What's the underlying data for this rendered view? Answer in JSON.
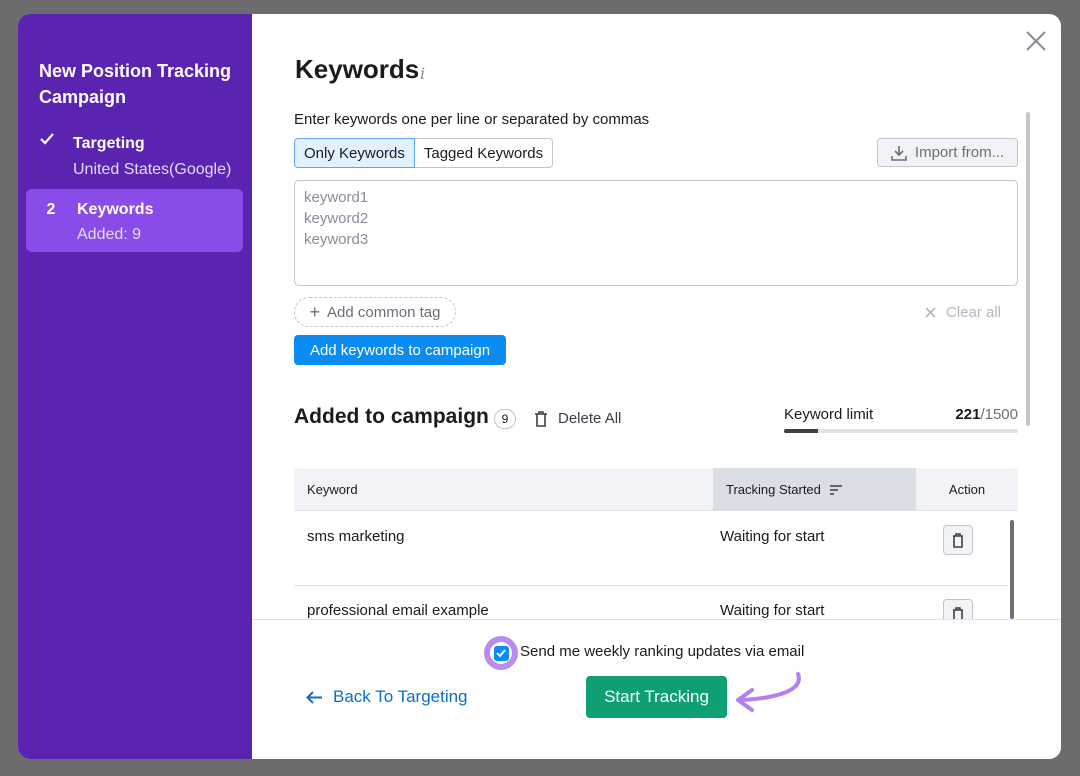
{
  "sidebar": {
    "title": "New Position Tracking Campaign",
    "steps": [
      {
        "icon": "check-icon",
        "label": "Targeting",
        "sub": "United States(Google)"
      },
      {
        "number": "2",
        "label": "Keywords",
        "sub": "Added: 9"
      }
    ]
  },
  "main": {
    "title": "Keywords",
    "info_glyph": "i",
    "hint": "Enter keywords one per line or separated by commas",
    "tabs": [
      "Only Keywords",
      "Tagged Keywords"
    ],
    "import_label": "Import from...",
    "placeholder_lines": [
      "keyword1",
      "keyword2",
      "keyword3"
    ],
    "add_tag_label": "Add common tag",
    "clear_all_label": "Clear all",
    "add_keywords_label": "Add keywords to campaign"
  },
  "campaign": {
    "title": "Added to campaign",
    "count": "9",
    "delete_all_label": "Delete All",
    "limit_label": "Keyword limit",
    "limit_used": "221",
    "limit_max": "/1500",
    "limit_fraction": 0.147
  },
  "table": {
    "columns": {
      "keyword": "Keyword",
      "tracking": "Tracking Started",
      "action": "Action"
    },
    "rows": [
      {
        "keyword": "sms marketing",
        "status": "Waiting for start"
      },
      {
        "keyword": "professional email example",
        "status": "Waiting for start"
      }
    ]
  },
  "footer": {
    "checkbox_label": "Send me weekly ranking updates via email",
    "checked": true,
    "back_label": "Back To Targeting",
    "start_label": "Start Tracking"
  },
  "colors": {
    "sidebar": "#5a24b0",
    "active_step": "#8a4ce8",
    "primary_blue": "#0b8cf2",
    "start_green": "#0e9f74",
    "highlight_purple": "#b98cf0"
  }
}
